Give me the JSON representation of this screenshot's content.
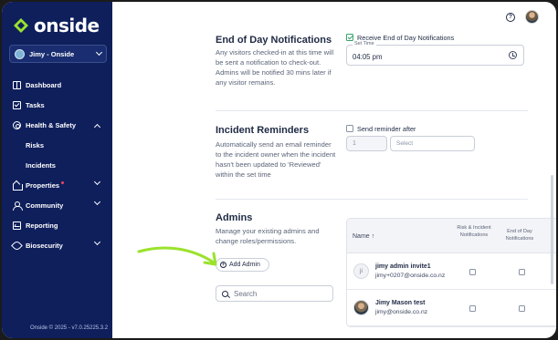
{
  "app": {
    "name": "onside",
    "version": "Onside © 2025 - v7.0.25225.3.2"
  },
  "account": {
    "name": "Jimy - Onside"
  },
  "sidebar": {
    "items": [
      {
        "label": "Dashboard",
        "icon": "dashboard-icon"
      },
      {
        "label": "Tasks",
        "icon": "tasks-icon"
      },
      {
        "label": "Health & Safety",
        "icon": "health-safety-icon",
        "expanded": true
      },
      {
        "label": "Risks",
        "sub": true
      },
      {
        "label": "Incidents",
        "sub": true
      },
      {
        "label": "Properties",
        "icon": "properties-icon",
        "badge": true
      },
      {
        "label": "Community",
        "icon": "community-icon"
      },
      {
        "label": "Reporting",
        "icon": "reporting-icon"
      },
      {
        "label": "Biosecurity",
        "icon": "biosecurity-icon"
      }
    ]
  },
  "topbar": {
    "help": "?"
  },
  "eod": {
    "title": "End of Day Notifications",
    "description": "Any visitors checked-in at this time will be sent a notification to check-out. Admins will be notified 30 mins later if any visitor remains.",
    "checkbox_label": "Receive End of Day Notifications",
    "checked": true,
    "set_time_label": "Set Time",
    "set_time_value": "04:05 pm"
  },
  "incident": {
    "title": "Incident Reminders",
    "description": "Automatically send an email reminder to the incident owner when the incident hasn't been updated to 'Reviewed' within the set time",
    "checkbox_label": "Send reminder after",
    "checked": false,
    "number_value": "1",
    "select_placeholder": "Select"
  },
  "admins": {
    "title": "Admins",
    "description": "Manage your existing admins and change roles/permissions.",
    "add_button": "Add Admin",
    "search_placeholder": "Search",
    "columns": {
      "name": "Name",
      "col1": "Risk & Incident Notifications",
      "col2": "End of Day Notifications"
    },
    "rows": [
      {
        "initials": "ji",
        "name": "jimy admin invite1",
        "email": "jimy+0207@onside.co.nz"
      },
      {
        "initials": "",
        "name": "Jimy Mason test",
        "email": "jimy@onside.co.nz"
      }
    ]
  },
  "colors": {
    "sidebar": "#0f1f5c",
    "accent_green": "#9be22d",
    "check_green": "#38a169"
  }
}
